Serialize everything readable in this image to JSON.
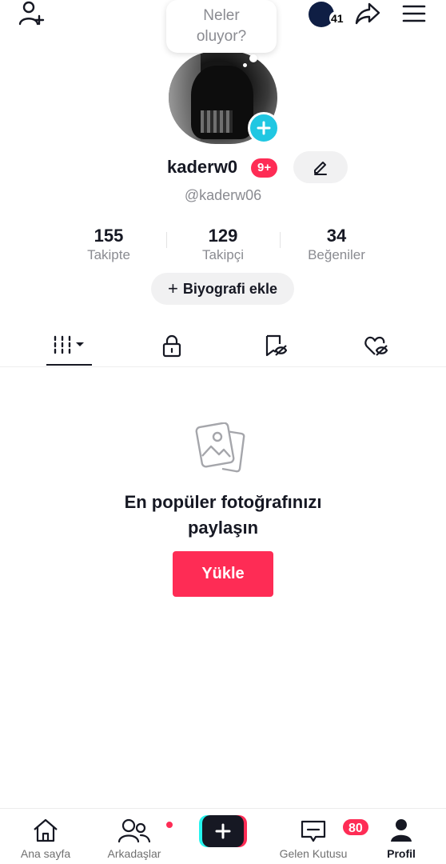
{
  "note": {
    "line1": "Neler",
    "line2": "oluyor?"
  },
  "header": {
    "story_count": "41"
  },
  "profile": {
    "username": "kaderw0",
    "notif_badge": "9+",
    "handle": "@kaderw06"
  },
  "stats": [
    {
      "value": "155",
      "label": "Takipte"
    },
    {
      "value": "129",
      "label": "Takipçi"
    },
    {
      "value": "34",
      "label": "Beğeniler"
    }
  ],
  "bio": {
    "plus": "+",
    "label": "Biyografi ekle"
  },
  "empty_state": {
    "title_line1": "En popüler fotoğrafınızı",
    "title_line2": "paylaşın",
    "button": "Yükle"
  },
  "nav": {
    "home": "Ana sayfa",
    "friends": "Arkadaşlar",
    "inbox": "Gelen Kutusu",
    "inbox_badge": "80",
    "profile": "Profil"
  },
  "colors": {
    "accent": "#fe2c55",
    "cyan": "#25f4ee",
    "avatar_plus": "#20c7e2",
    "text": "#161823",
    "muted": "#8a8b91"
  }
}
